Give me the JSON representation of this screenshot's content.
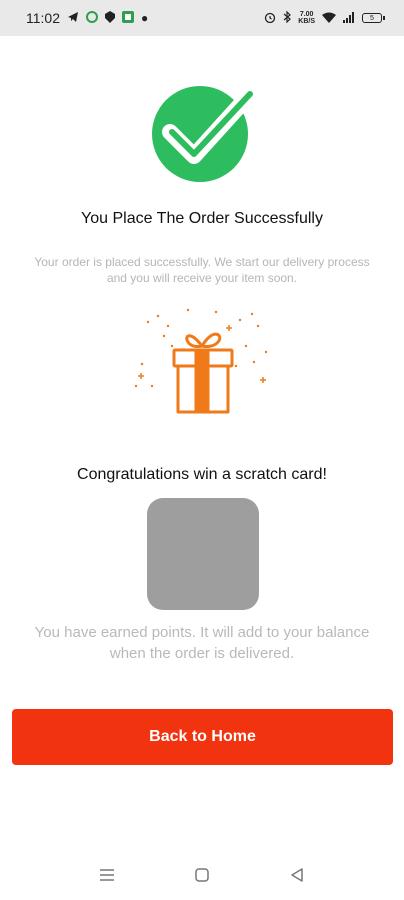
{
  "status_bar": {
    "time": "11:02",
    "net_speed_value": "7.00",
    "net_speed_unit": "KB/S",
    "left_icons": [
      "telegram-icon",
      "whatsapp-icon",
      "vpn-icon",
      "app-icon",
      "dot-icon"
    ],
    "right_icons": [
      "alarm-icon",
      "bluetooth-icon",
      "wifi-icon",
      "signal-icon",
      "battery-icon"
    ],
    "battery_level": "5"
  },
  "success": {
    "title": "You Place The Order Successfully",
    "subtitle": "Your order is placed successfully. We start our delivery process and you will receive your item soon."
  },
  "reward": {
    "congrats_text": "Congratulations win a scratch card!",
    "points_message": "You have earned  points. It will add to your balance when the order is delivered."
  },
  "actions": {
    "back_home_label": "Back to Home"
  },
  "colors": {
    "success_green": "#2ebd5e",
    "gift_orange": "#f07a1a",
    "button_red": "#f2330f",
    "scratch_gray": "#9e9e9e"
  },
  "nav_icons": [
    "menu-icon",
    "home-square-icon",
    "back-triangle-icon"
  ]
}
